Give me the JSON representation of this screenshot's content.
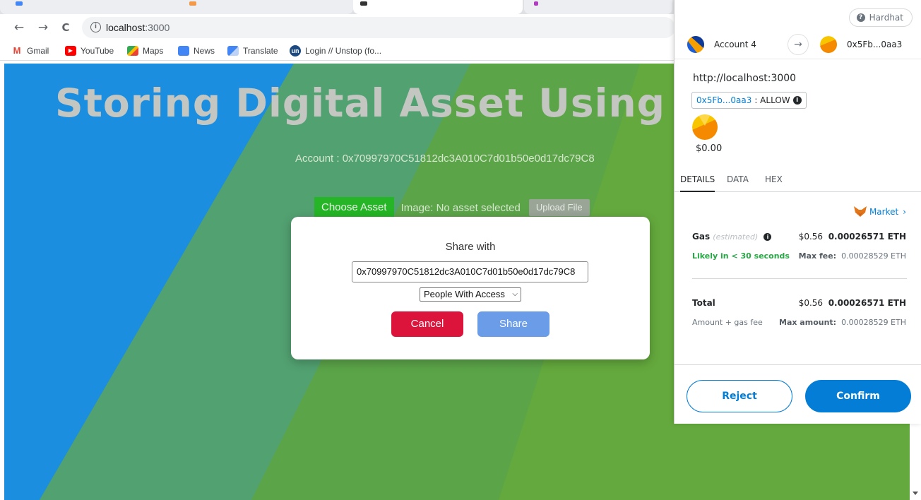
{
  "browser": {
    "nav": {
      "back": "←",
      "forward": "→",
      "reload": "C"
    },
    "url_host": "localhost",
    "url_port": ":3000",
    "bookmarks": [
      {
        "label": "Gmail",
        "icon": "gmail-icon",
        "color": "#ea4335",
        "glyph": "M"
      },
      {
        "label": "YouTube",
        "icon": "youtube-icon",
        "color": "#ff0000",
        "glyph": "▶"
      },
      {
        "label": "Maps",
        "icon": "maps-icon",
        "color": "#34a853",
        "glyph": ""
      },
      {
        "label": "News",
        "icon": "news-icon",
        "color": "#4285f4",
        "glyph": ""
      },
      {
        "label": "Translate",
        "icon": "translate-icon",
        "color": "#4285f4",
        "glyph": ""
      },
      {
        "label": "Login // Unstop (fo...",
        "icon": "unstop-icon",
        "color": "#1c4980",
        "glyph": "un"
      }
    ]
  },
  "page": {
    "title": "Storing Digital Asset Using Bl",
    "account_line": "Account : 0x70997970C51812dc3A010C7d01b50e0d17dc79C8",
    "choose_label": "Choose Asset",
    "image_status": "Image: No asset selected",
    "upload_label": "Upload File",
    "colors": {
      "green": "#64a93d",
      "blue": "#1c8ee0",
      "button_green": "#25b526"
    }
  },
  "modal": {
    "title": "Share with",
    "address_value": "0x70997970C51812dc3A010C7d01b50e0d17dc79C8",
    "select_value": "People With Access",
    "cancel_label": "Cancel",
    "share_label": "Share",
    "colors": {
      "cancel": "#dc143c",
      "share": "#6a9ce8"
    }
  },
  "metamask": {
    "network": "Hardhat",
    "from_account": "Account 4",
    "to_address": "0x5Fb...0aa3",
    "origin": "http://localhost:3000",
    "allow_address": "0x5Fb...0aa3",
    "allow_text": ": ALLOW",
    "amount": "$0.00",
    "tabs": [
      "DETAILS",
      "DATA",
      "HEX"
    ],
    "market_label": "Market",
    "gas": {
      "label": "Gas",
      "estimated": "(estimated)",
      "usd": "$0.56",
      "eth": "0.00026571 ETH",
      "likely": "Likely in < 30 seconds",
      "max_fee_label": "Max fee:",
      "max_fee_value": "0.00028529 ETH"
    },
    "total": {
      "label": "Total",
      "usd": "$0.56",
      "eth": "0.00026571 ETH",
      "sub_label": "Amount + gas fee",
      "max_amount_label": "Max amount:",
      "max_amount_value": "0.00028529 ETH"
    },
    "reject_label": "Reject",
    "confirm_label": "Confirm",
    "colors": {
      "primary": "#037dd6",
      "success": "#28a745"
    }
  }
}
